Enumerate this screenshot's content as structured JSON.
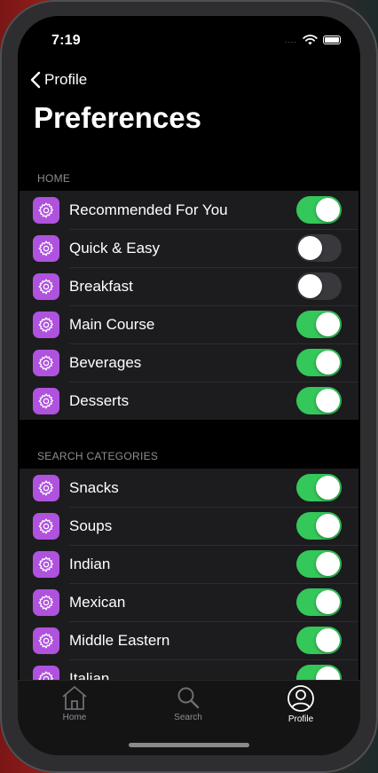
{
  "status": {
    "time": "7:19",
    "signal_dots": "...."
  },
  "nav": {
    "back_label": "Profile",
    "title": "Preferences"
  },
  "sections": [
    {
      "header": "HOME",
      "items": [
        {
          "label": "Recommended For You",
          "enabled": true
        },
        {
          "label": "Quick & Easy",
          "enabled": false
        },
        {
          "label": "Breakfast",
          "enabled": false
        },
        {
          "label": "Main Course",
          "enabled": true
        },
        {
          "label": "Beverages",
          "enabled": true
        },
        {
          "label": "Desserts",
          "enabled": true
        }
      ]
    },
    {
      "header": "SEARCH CATEGORIES",
      "items": [
        {
          "label": "Snacks",
          "enabled": true
        },
        {
          "label": "Soups",
          "enabled": true
        },
        {
          "label": "Indian",
          "enabled": true
        },
        {
          "label": "Mexican",
          "enabled": true
        },
        {
          "label": "Middle Eastern",
          "enabled": true
        },
        {
          "label": "Italian",
          "enabled": true
        }
      ]
    }
  ],
  "tabbar": {
    "home": "Home",
    "search": "Search",
    "profile": "Profile",
    "active": "profile"
  },
  "colors": {
    "accent_on": "#34c759",
    "icon_bg": "#af52de",
    "toggle_off": "#39393d"
  },
  "icons": {
    "row_icon": "gear-icon"
  }
}
